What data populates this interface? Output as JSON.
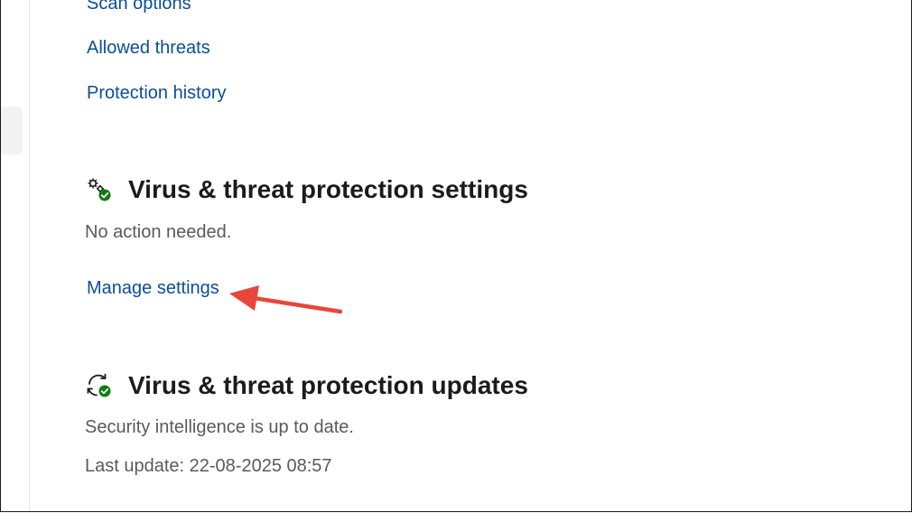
{
  "links": {
    "scan_options": "Scan options",
    "allowed_threats": "Allowed threats",
    "protection_history": "Protection history"
  },
  "settings_section": {
    "title": "Virus & threat protection settings",
    "status": "No action needed.",
    "manage_link": "Manage settings",
    "icon": "gears-check-icon"
  },
  "updates_section": {
    "title": "Virus & threat protection updates",
    "status": "Security intelligence is up to date.",
    "last_update": "Last update: 22-08-2025 08:57",
    "icon": "refresh-check-icon"
  },
  "colors": {
    "link": "#0b4d9a",
    "heading": "#1b1b1b",
    "status_text": "#5a5a5a",
    "check_badge": "#107c10",
    "annotation_arrow": "#e8463a"
  }
}
